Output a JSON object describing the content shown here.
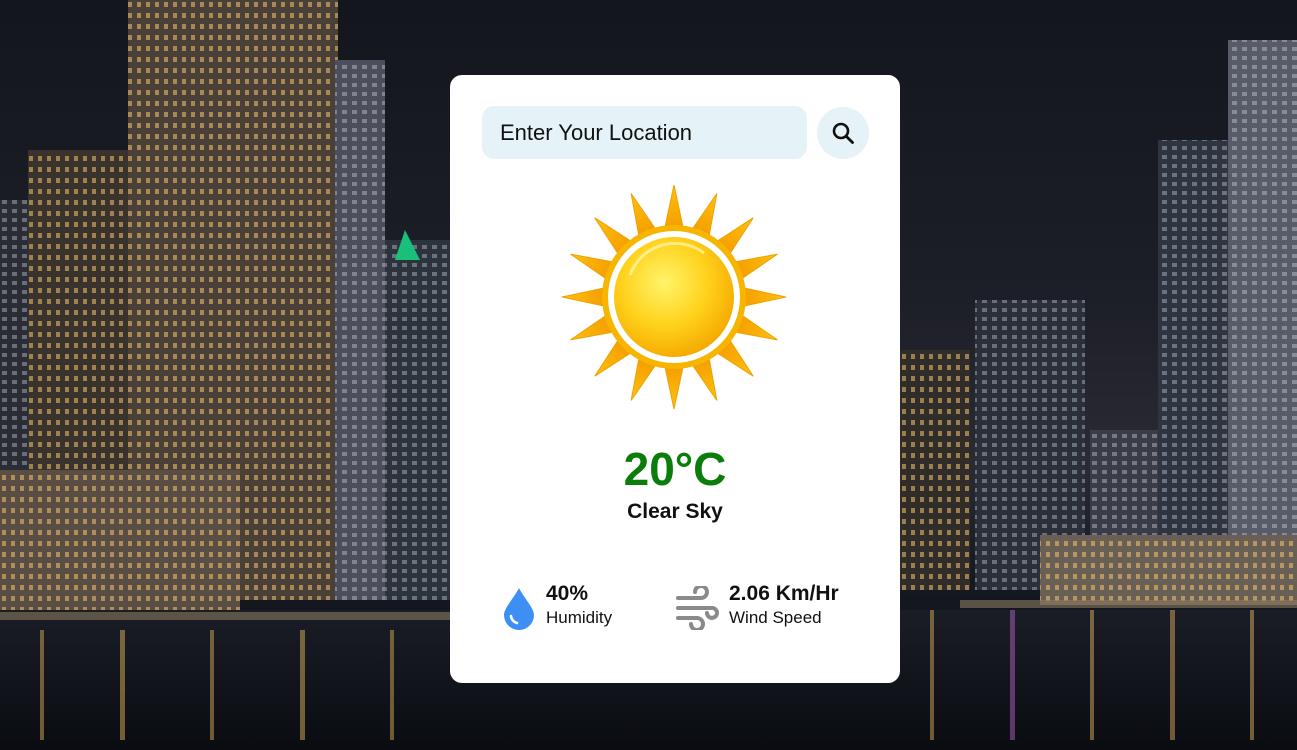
{
  "search": {
    "placeholder": "Enter Your Location",
    "button_icon": "search-icon"
  },
  "weather": {
    "icon": "sun-icon",
    "temperature": "20°C",
    "description": "Clear Sky",
    "temperature_color": "#0a7d0a"
  },
  "details": {
    "humidity": {
      "value": "40%",
      "label": "Humidity",
      "icon": "water-drop-icon",
      "icon_color": "#3d8ff5"
    },
    "wind": {
      "value": "2.06 Km/Hr",
      "label": "Wind Speed",
      "icon": "wind-icon"
    }
  }
}
